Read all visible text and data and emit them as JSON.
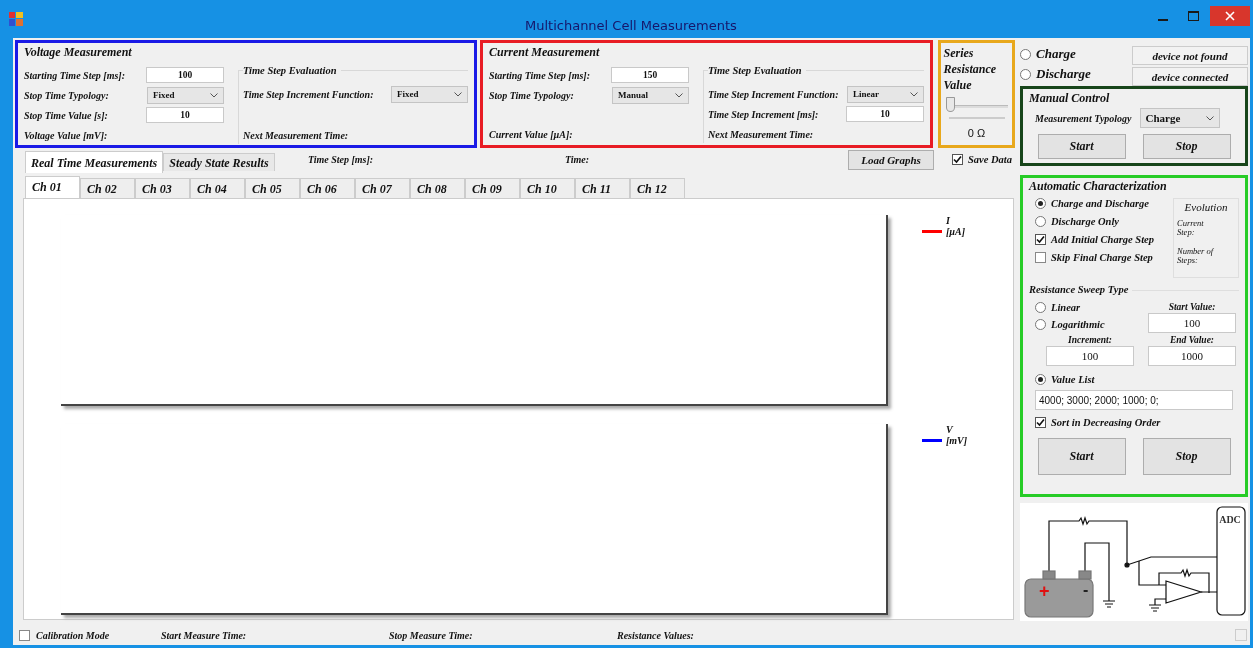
{
  "window": {
    "title": "Multichannel Cell Measurements"
  },
  "voltage": {
    "title": "Voltage Measurement",
    "rows": [
      {
        "label": "Starting Time Step [ms]:",
        "kind": "input",
        "value": "100"
      },
      {
        "label": "Stop Time Typology:",
        "kind": "select",
        "value": "Fixed"
      },
      {
        "label": "Stop Time Value [s]:",
        "kind": "input",
        "value": "10"
      },
      {
        "label": "Voltage Value [mV]:",
        "kind": "text"
      }
    ],
    "evaluation": {
      "title": "Time Step Evaluation",
      "rows": [
        {
          "label": "Time Step Increment Function:",
          "kind": "select",
          "value": "Fixed"
        },
        {
          "label": "Next Measurement Time:",
          "kind": "text"
        }
      ]
    }
  },
  "current": {
    "title": "Current Measurement",
    "rows": [
      {
        "label": "Starting Time Step [ms]:",
        "kind": "input",
        "value": "150"
      },
      {
        "label": "Stop Time Typology:",
        "kind": "select",
        "value": "Manual"
      },
      {
        "label": "Current Value [µA]:",
        "kind": "text"
      }
    ],
    "evaluation": {
      "title": "Time Step Evaluation",
      "rows": [
        {
          "label": "Time Step Increment Function:",
          "kind": "select",
          "value": "Linear"
        },
        {
          "label": "Time Step Increment [ms]:",
          "kind": "input",
          "value": "10"
        },
        {
          "label": "Next Measurement Time:",
          "kind": "text"
        }
      ]
    }
  },
  "series": {
    "title": "Series Resistance Value",
    "level": 0,
    "reading": "0 Ω"
  },
  "mode": [
    {
      "label": "Charge",
      "selected": false
    },
    {
      "label": "Discharge",
      "selected": false
    }
  ],
  "device_status": [
    "device not found",
    "device connected"
  ],
  "manual": {
    "title": "Manual Control",
    "typology_label": "Measurement Typology",
    "typology": "Charge",
    "buttons": [
      "Start",
      "Stop"
    ]
  },
  "view_tabs": [
    {
      "label": "Real Time Measurements",
      "selected": true
    },
    {
      "label": "Steady State Results",
      "selected": false
    }
  ],
  "info_labels": [
    "Time Step [ms]:",
    "Time:"
  ],
  "load_button": "Load Graphs",
  "save_data": {
    "label": "Save Data",
    "checked": true
  },
  "channels": [
    {
      "label": "Ch 01",
      "selected": true
    },
    {
      "label": "Ch 02",
      "selected": false
    },
    {
      "label": "Ch 03",
      "selected": false
    },
    {
      "label": "Ch 04",
      "selected": false
    },
    {
      "label": "Ch 05",
      "selected": false
    },
    {
      "label": "Ch 06",
      "selected": false
    },
    {
      "label": "Ch 07",
      "selected": false
    },
    {
      "label": "Ch 08",
      "selected": false
    },
    {
      "label": "Ch 09",
      "selected": false
    },
    {
      "label": "Ch 10",
      "selected": false
    },
    {
      "label": "Ch 11",
      "selected": false
    },
    {
      "label": "Ch 12",
      "selected": false
    }
  ],
  "plots": [
    {
      "legend": "I",
      "unit": "[µA]",
      "color": "#ff0000"
    },
    {
      "legend": "V",
      "unit": "[mV]",
      "color": "#0000ff"
    }
  ],
  "auto": {
    "title": "Automatic Characterization",
    "options": [
      {
        "label": "Charge and Discharge",
        "kind": "radio",
        "selected": true
      },
      {
        "label": "Discharge Only",
        "kind": "radio",
        "selected": false
      },
      {
        "label": "Add Initial Charge Step",
        "kind": "checkbox",
        "checked": true
      },
      {
        "label": "Skip Final Charge Step",
        "kind": "checkbox",
        "checked": false
      }
    ],
    "evolution": {
      "title": "Evolution",
      "labels": [
        "Current Step:",
        "Number of Steps:"
      ]
    },
    "sweep": {
      "title": "Resistance Sweep Type",
      "options": [
        {
          "label": "Linear",
          "selected": false
        },
        {
          "label": "Logarithmic",
          "selected": false
        }
      ],
      "start": {
        "label": "Start Value:",
        "value": "100"
      },
      "increment": {
        "label": "Increment:",
        "value": "100"
      },
      "end": {
        "label": "End Value:",
        "value": "1000"
      },
      "value_list": {
        "label": "Value List",
        "selected": true,
        "value": "4000; 3000; 2000; 1000; 0;"
      },
      "sort": {
        "label": "Sort in Decreasing Order",
        "checked": true
      }
    },
    "buttons": [
      "Start",
      "Stop"
    ]
  },
  "circuit": {
    "adc": "ADC",
    "plus": "+",
    "minus": "-"
  },
  "status_bar": {
    "calibration": {
      "label": "Calibration Mode",
      "checked": false
    },
    "labels": [
      "Start Measure Time:",
      "Stop Measure Time:",
      "Resistance Values:"
    ]
  }
}
